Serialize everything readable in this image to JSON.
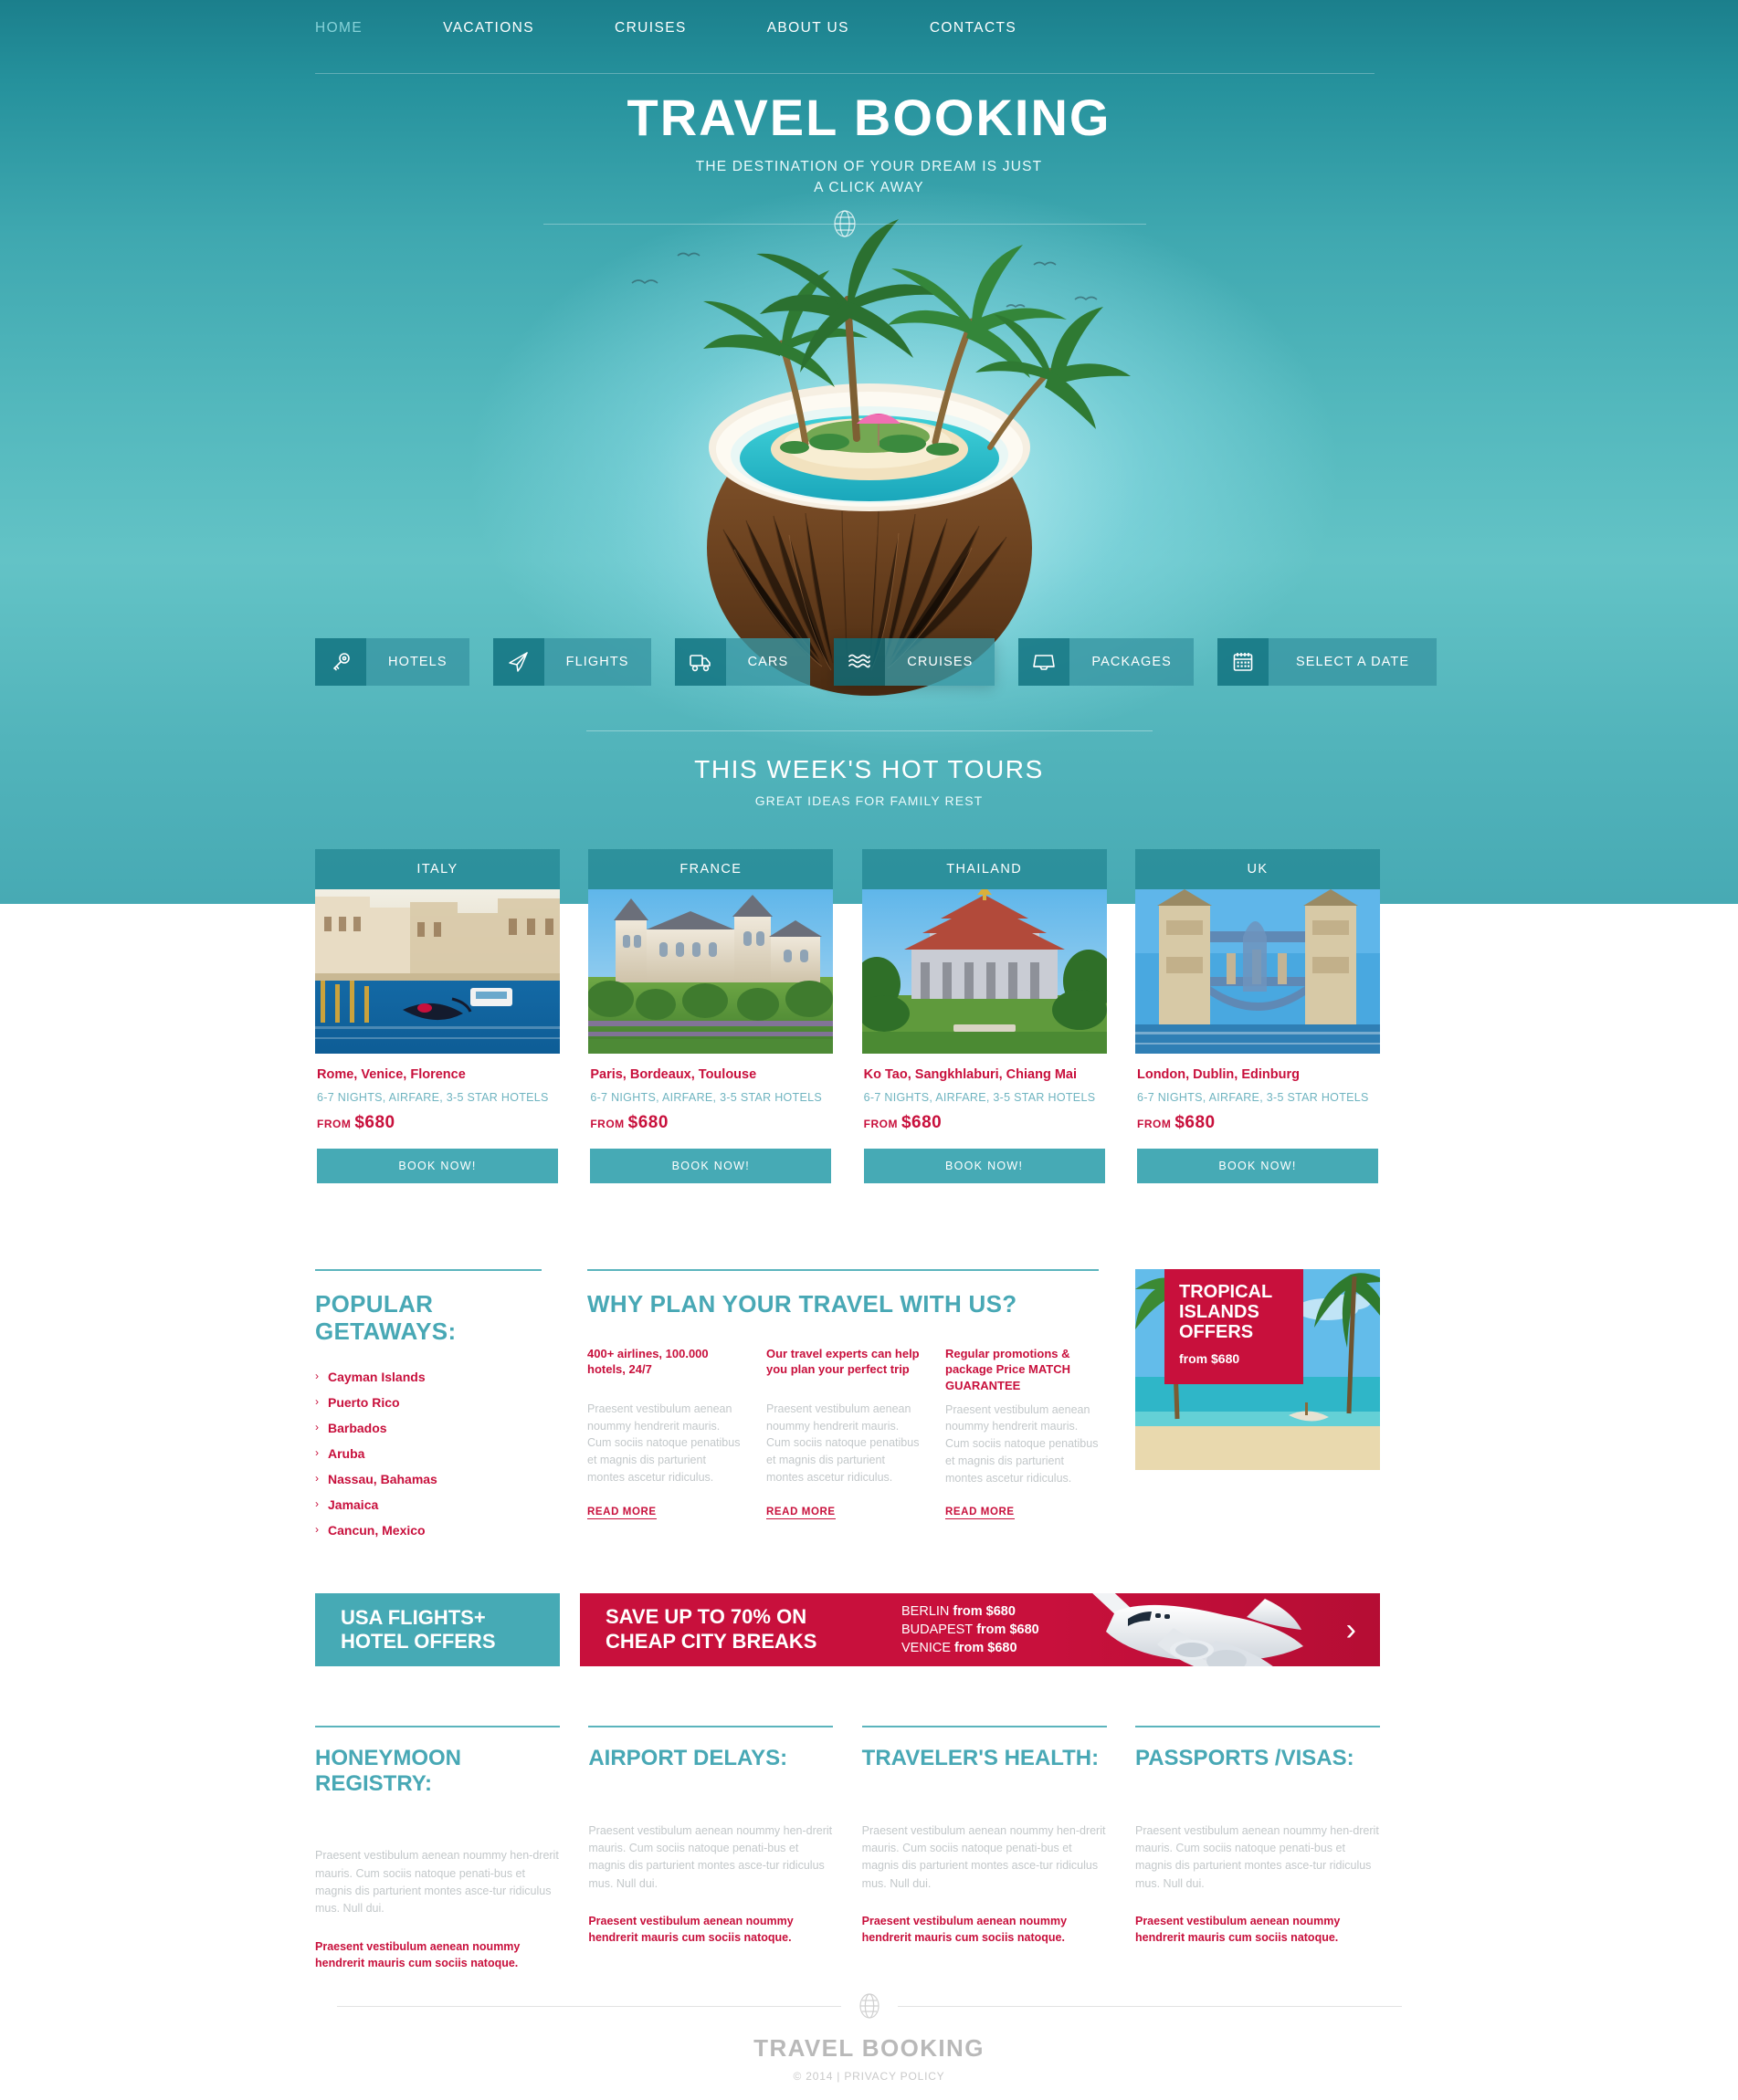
{
  "nav": {
    "items": [
      {
        "label": "HOME",
        "active": true
      },
      {
        "label": "VACATIONS",
        "active": false
      },
      {
        "label": "CRUISES",
        "active": false
      },
      {
        "label": "ABOUT US",
        "active": false
      },
      {
        "label": "CONTACTS",
        "active": false
      }
    ]
  },
  "brand": {
    "title": "TRAVEL BOOKING",
    "tagline_line1": "THE DESTINATION OF YOUR DREAM IS JUST",
    "tagline_line2": "A CLICK AWAY"
  },
  "search": {
    "buttons": [
      {
        "label": "HOTELS",
        "icon": "key-icon"
      },
      {
        "label": "FLIGHTS",
        "icon": "paper-plane-icon"
      },
      {
        "label": "CARS",
        "icon": "van-icon"
      },
      {
        "label": "CRUISES",
        "icon": "waves-icon"
      },
      {
        "label": "PACKAGES",
        "icon": "tray-icon"
      },
      {
        "label": "SELECT A DATE",
        "icon": "calendar-icon"
      }
    ]
  },
  "tours": {
    "heading": "THIS WEEK'S HOT TOURS",
    "subheading": "GREAT IDEAS FOR FAMILY REST",
    "cards": [
      {
        "country": "ITALY",
        "cities": "Rome, Venice, Florence",
        "details": "6-7 NIGHTS, AIRFARE, 3-5 STAR HOTELS",
        "price_prefix": "FROM",
        "price": "$680",
        "button": "BOOK NOW!",
        "image": "venice-canal-gondola-photo"
      },
      {
        "country": "FRANCE",
        "cities": "Paris, Bordeaux, Toulouse",
        "details": "6-7 NIGHTS, AIRFARE, 3-5 STAR HOTELS",
        "price_prefix": "FROM",
        "price": "$680",
        "button": "BOOK NOW!",
        "image": "french-chateau-photo"
      },
      {
        "country": "THAILAND",
        "cities": "Ko Tao, Sangkhlaburi, Chiang Mai",
        "details": "6-7 NIGHTS, AIRFARE, 3-5 STAR HOTELS",
        "price_prefix": "FROM",
        "price": "$680",
        "button": "BOOK NOW!",
        "image": "thai-temple-photo"
      },
      {
        "country": "UK",
        "cities": "London, Dublin, Edinburg",
        "details": "6-7 NIGHTS, AIRFARE, 3-5 STAR HOTELS",
        "price_prefix": "FROM",
        "price": "$680",
        "button": "BOOK NOW!",
        "image": "tower-bridge-photo"
      }
    ]
  },
  "popular": {
    "heading": "POPULAR GETAWAYS:",
    "items": [
      "Cayman Islands",
      "Puerto Rico",
      "Barbados",
      "Aruba",
      "Nassau, Bahamas",
      "Jamaica",
      "Cancun, Mexico"
    ]
  },
  "why": {
    "heading": "WHY PLAN YOUR TRAVEL WITH US?",
    "columns": [
      {
        "title": "400+ airlines, 100.000 hotels, 24/7",
        "body": "Praesent vestibulum aenean noummy hendrerit mauris. Cum sociis natoque penatibus et magnis dis parturient montes ascetur ridiculus.",
        "link": "READ MORE"
      },
      {
        "title": "Our travel experts can help you plan your perfect trip",
        "body": "Praesent vestibulum aenean noummy hendrerit mauris. Cum sociis natoque penatibus et magnis dis parturient montes ascetur ridiculus.",
        "link": "READ MORE"
      },
      {
        "title": "Regular promotions & package Price MATCH GUARANTEE",
        "body": "Praesent vestibulum aenean noummy hendrerit mauris. Cum sociis natoque penatibus et magnis dis parturient montes ascetur ridiculus.",
        "link": "READ MORE"
      }
    ]
  },
  "promo_box": {
    "title_line1": "TROPICAL",
    "title_line2": "ISLANDS",
    "title_line3": "OFFERS",
    "from": "from $680",
    "image": "tropical-beach-palms-boat-photo"
  },
  "banner": {
    "teal_line1": "USA FLIGHTS+",
    "teal_line2": "HOTEL OFFERS",
    "red_line1": "SAVE UP TO 70% ON",
    "red_line2": "CHEAP CITY BREAKS",
    "destinations": [
      {
        "city": "BERLIN",
        "price": "from $680"
      },
      {
        "city": "BUDAPEST",
        "price": "from $680"
      },
      {
        "city": "VENICE",
        "price": "from $680"
      }
    ],
    "next_label": "›"
  },
  "bottom": {
    "columns": [
      {
        "heading": "HONEYMOON REGISTRY:",
        "body": "Praesent vestibulum aenean noummy hen-drerit mauris. Cum sociis natoque penati-bus et magnis dis parturient montes asce-tur ridiculus mus. Null dui.",
        "quote": "Praesent vestibulum aenean noummy hendrerit mauris cum sociis natoque."
      },
      {
        "heading": "AIRPORT DELAYS:",
        "body": "Praesent vestibulum aenean noummy hen-drerit mauris. Cum sociis natoque penati-bus et magnis dis parturient montes asce-tur ridiculus mus. Null dui.",
        "quote": "Praesent vestibulum aenean noummy hendrerit mauris cum sociis natoque."
      },
      {
        "heading": "TRAVELER'S HEALTH:",
        "body": "Praesent vestibulum aenean noummy hen-drerit mauris. Cum sociis natoque penati-bus et magnis dis parturient montes asce-tur ridiculus mus. Null dui.",
        "quote": "Praesent vestibulum aenean noummy hendrerit mauris cum sociis natoque."
      },
      {
        "heading": "PASSPORTS /VISAS:",
        "body": "Praesent vestibulum aenean noummy hen-drerit mauris. Cum sociis natoque penati-bus et magnis dis parturient montes asce-tur ridiculus mus. Null dui.",
        "quote": "Praesent vestibulum aenean noummy hendrerit mauris cum sociis natoque."
      }
    ]
  },
  "footer": {
    "name": "TRAVEL BOOKING",
    "copyright": "© 2014 | ",
    "privacy": "PRIVACY POLICY"
  },
  "colors": {
    "teal": "#46aab5",
    "teal_dark": "#1b7f8c",
    "red": "#c8103c",
    "heading_teal": "#48a8b5",
    "muted": "#c3c8ca"
  }
}
